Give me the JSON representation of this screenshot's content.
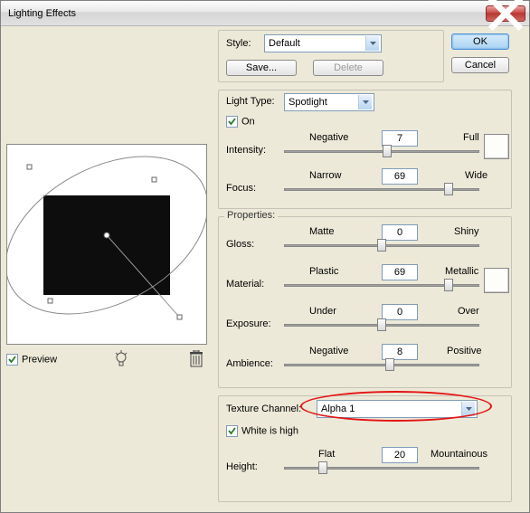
{
  "window": {
    "title": "Lighting Effects"
  },
  "buttons": {
    "ok": "OK",
    "cancel": "Cancel",
    "save": "Save...",
    "delete": "Delete"
  },
  "style": {
    "label": "Style:",
    "value": "Default"
  },
  "lightType": {
    "label": "Light Type:",
    "value": "Spotlight",
    "on_label": "On",
    "on_checked": true
  },
  "intensity": {
    "label": "Intensity:",
    "left": "Negative",
    "right": "Full",
    "value": "7"
  },
  "focus": {
    "label": "Focus:",
    "left": "Narrow",
    "right": "Wide",
    "value": "69"
  },
  "properties_label": "Properties:",
  "gloss": {
    "label": "Gloss:",
    "left": "Matte",
    "right": "Shiny",
    "value": "0"
  },
  "material": {
    "label": "Material:",
    "left": "Plastic",
    "right": "Metallic",
    "value": "69"
  },
  "exposure": {
    "label": "Exposure:",
    "left": "Under",
    "right": "Over",
    "value": "0"
  },
  "ambience": {
    "label": "Ambience:",
    "left": "Negative",
    "right": "Positive",
    "value": "8"
  },
  "texture": {
    "label": "Texture Channel:",
    "value": "Alpha 1",
    "white_label": "White is high",
    "white_checked": true
  },
  "height": {
    "label": "Height:",
    "left": "Flat",
    "right": "Mountainous",
    "value": "20"
  },
  "preview": {
    "label": "Preview",
    "checked": true
  }
}
